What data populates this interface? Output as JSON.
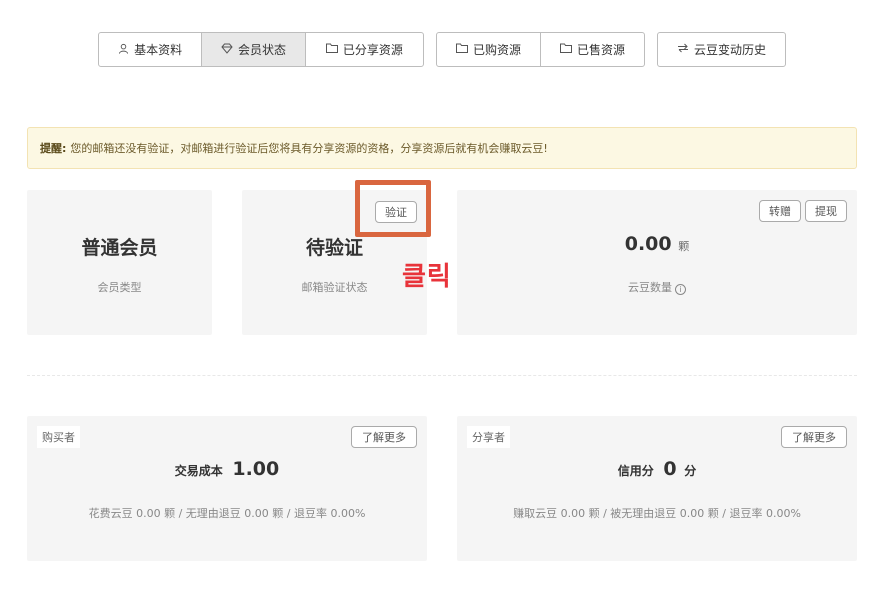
{
  "tabs_group1": [
    {
      "label": "基本资料",
      "icon": "user-icon"
    },
    {
      "label": "会员状态",
      "icon": "diamond-icon",
      "active": true
    },
    {
      "label": "已分享资源",
      "icon": "folder-icon"
    }
  ],
  "tabs_group2": [
    {
      "label": "已购资源",
      "icon": "folder-icon"
    },
    {
      "label": "已售资源",
      "icon": "folder-icon"
    }
  ],
  "tabs_group3": [
    {
      "label": "云豆变动历史",
      "icon": "exchange-icon"
    }
  ],
  "alert": {
    "label": "提醒:",
    "text": "您的邮箱还没有验证，对邮箱进行验证后您将具有分享资源的资格，分享资源后就有机会赚取云豆!"
  },
  "member": {
    "value": "普通会员",
    "label": "会员类型"
  },
  "email": {
    "value": "待验证",
    "label": "邮箱验证状态",
    "verify_button": "验证"
  },
  "beans": {
    "value": "0.00",
    "unit": "颗",
    "label": "云豆数量",
    "transfer_button": "转赠",
    "withdraw_button": "提现"
  },
  "annotation": {
    "text": "클릭",
    "color": "#e8333a",
    "box_color": "#d9663f"
  },
  "buyer": {
    "tag": "购买者",
    "more_button": "了解更多",
    "metric_label": "交易成本",
    "metric_value": "1.00",
    "details": "花费云豆 0.00 颗 / 无理由退豆 0.00 颗 / 退豆率 0.00%"
  },
  "sharer": {
    "tag": "分享者",
    "more_button": "了解更多",
    "metric_label": "信用分",
    "metric_value": "0",
    "metric_unit": "分",
    "details": "赚取云豆 0.00 颗 / 被无理由退豆 0.00 颗 / 退豆率 0.00%"
  }
}
